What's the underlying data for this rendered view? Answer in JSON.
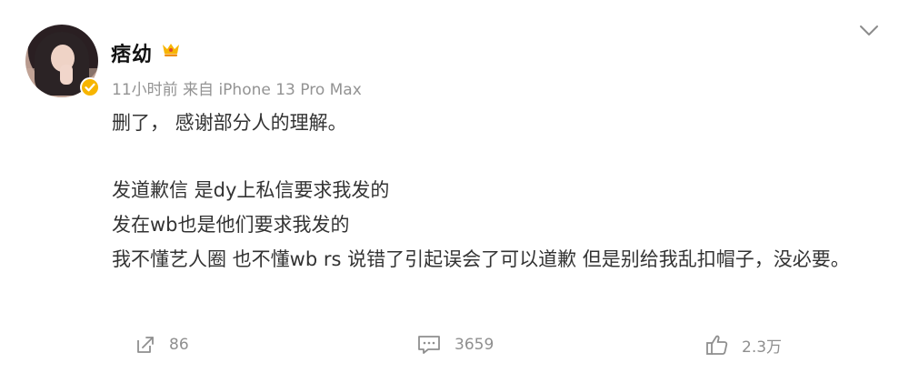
{
  "user": {
    "name": "痞幼",
    "meta": "11小时前  来自 iPhone 13 Pro Max"
  },
  "post": {
    "lines": [
      "删了，  感谢部分人的理解。",
      "发道歉信 是dy上私信要求我发的",
      "发在wb也是他们要求我发的",
      "我不懂艺人圈 也不懂wb rs 说错了引起误会了可以道歉 但是别给我乱扣帽子，没必要。"
    ]
  },
  "actions": {
    "share_count": "86",
    "comment_count": "3659",
    "like_count": "2.3万"
  },
  "icons": {
    "verified": "verified-badge-icon",
    "vip": "vip-crown-icon",
    "menu": "chevron-down-icon",
    "share": "share-icon",
    "comment": "comment-icon",
    "like": "thumbs-up-icon"
  },
  "colors": {
    "verified": "#f7b500",
    "vip": "#f7b500",
    "muted": "#939393"
  }
}
